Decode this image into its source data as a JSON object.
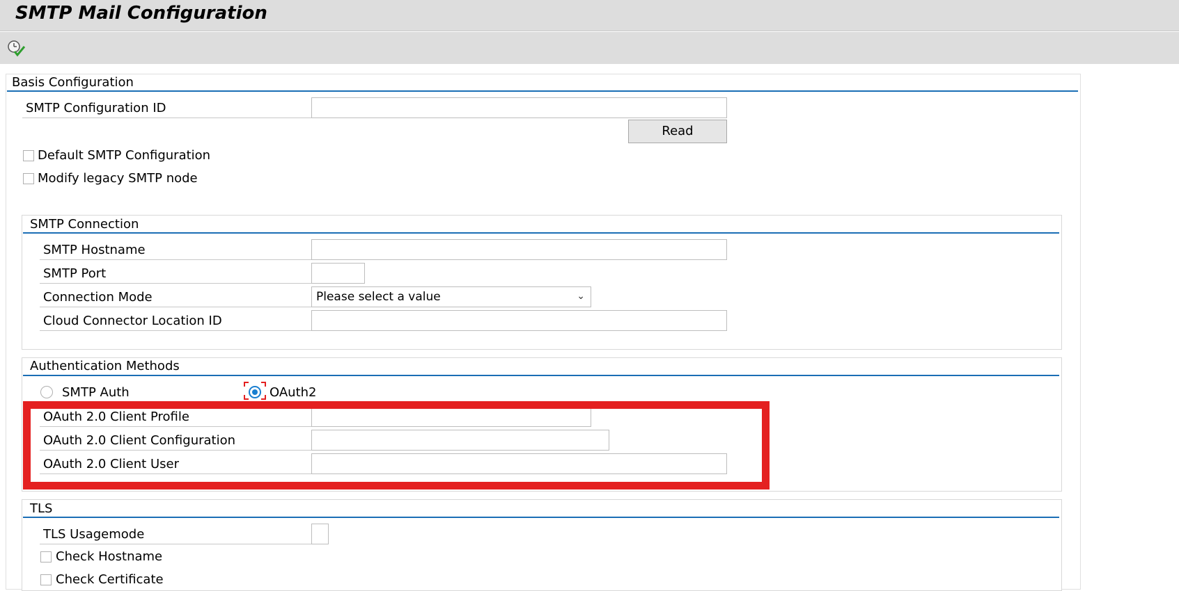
{
  "window": {
    "title": "SMTP Mail Configuration"
  },
  "toolbar": {
    "execute_icon": "clock-check-icon"
  },
  "basis": {
    "header": "Basis Configuration",
    "config_id_label": "SMTP Configuration ID",
    "config_id_value": "",
    "read_label": "Read",
    "default_label": "Default SMTP Configuration",
    "default_checked": false,
    "legacy_label": "Modify legacy SMTP node",
    "legacy_checked": false
  },
  "connection": {
    "header": "SMTP Connection",
    "hostname_label": "SMTP Hostname",
    "hostname_value": "",
    "port_label": "SMTP Port",
    "port_value": "",
    "mode_label": "Connection Mode",
    "mode_value": "Please select a value",
    "location_label": "Cloud Connector Location ID",
    "location_value": ""
  },
  "auth": {
    "header": "Authentication Methods",
    "smtp_auth_label": "SMTP Auth",
    "oauth2_label": "OAuth2",
    "selected": "OAuth2",
    "profile_label": "OAuth 2.0 Client Profile",
    "profile_value": "",
    "config_label": "OAuth 2.0 Client Configuration",
    "config_value": "",
    "user_label": "OAuth 2.0 Client User",
    "user_value": ""
  },
  "tls": {
    "header": "TLS",
    "usagemode_label": "TLS Usagemode",
    "usagemode_value": "",
    "check_hostname_label": "Check Hostname",
    "check_hostname_checked": false,
    "check_certificate_label": "Check Certificate"
  },
  "colors": {
    "highlight": "#e42020",
    "accent": "#1a6eb5",
    "chrome": "#dddddd"
  }
}
